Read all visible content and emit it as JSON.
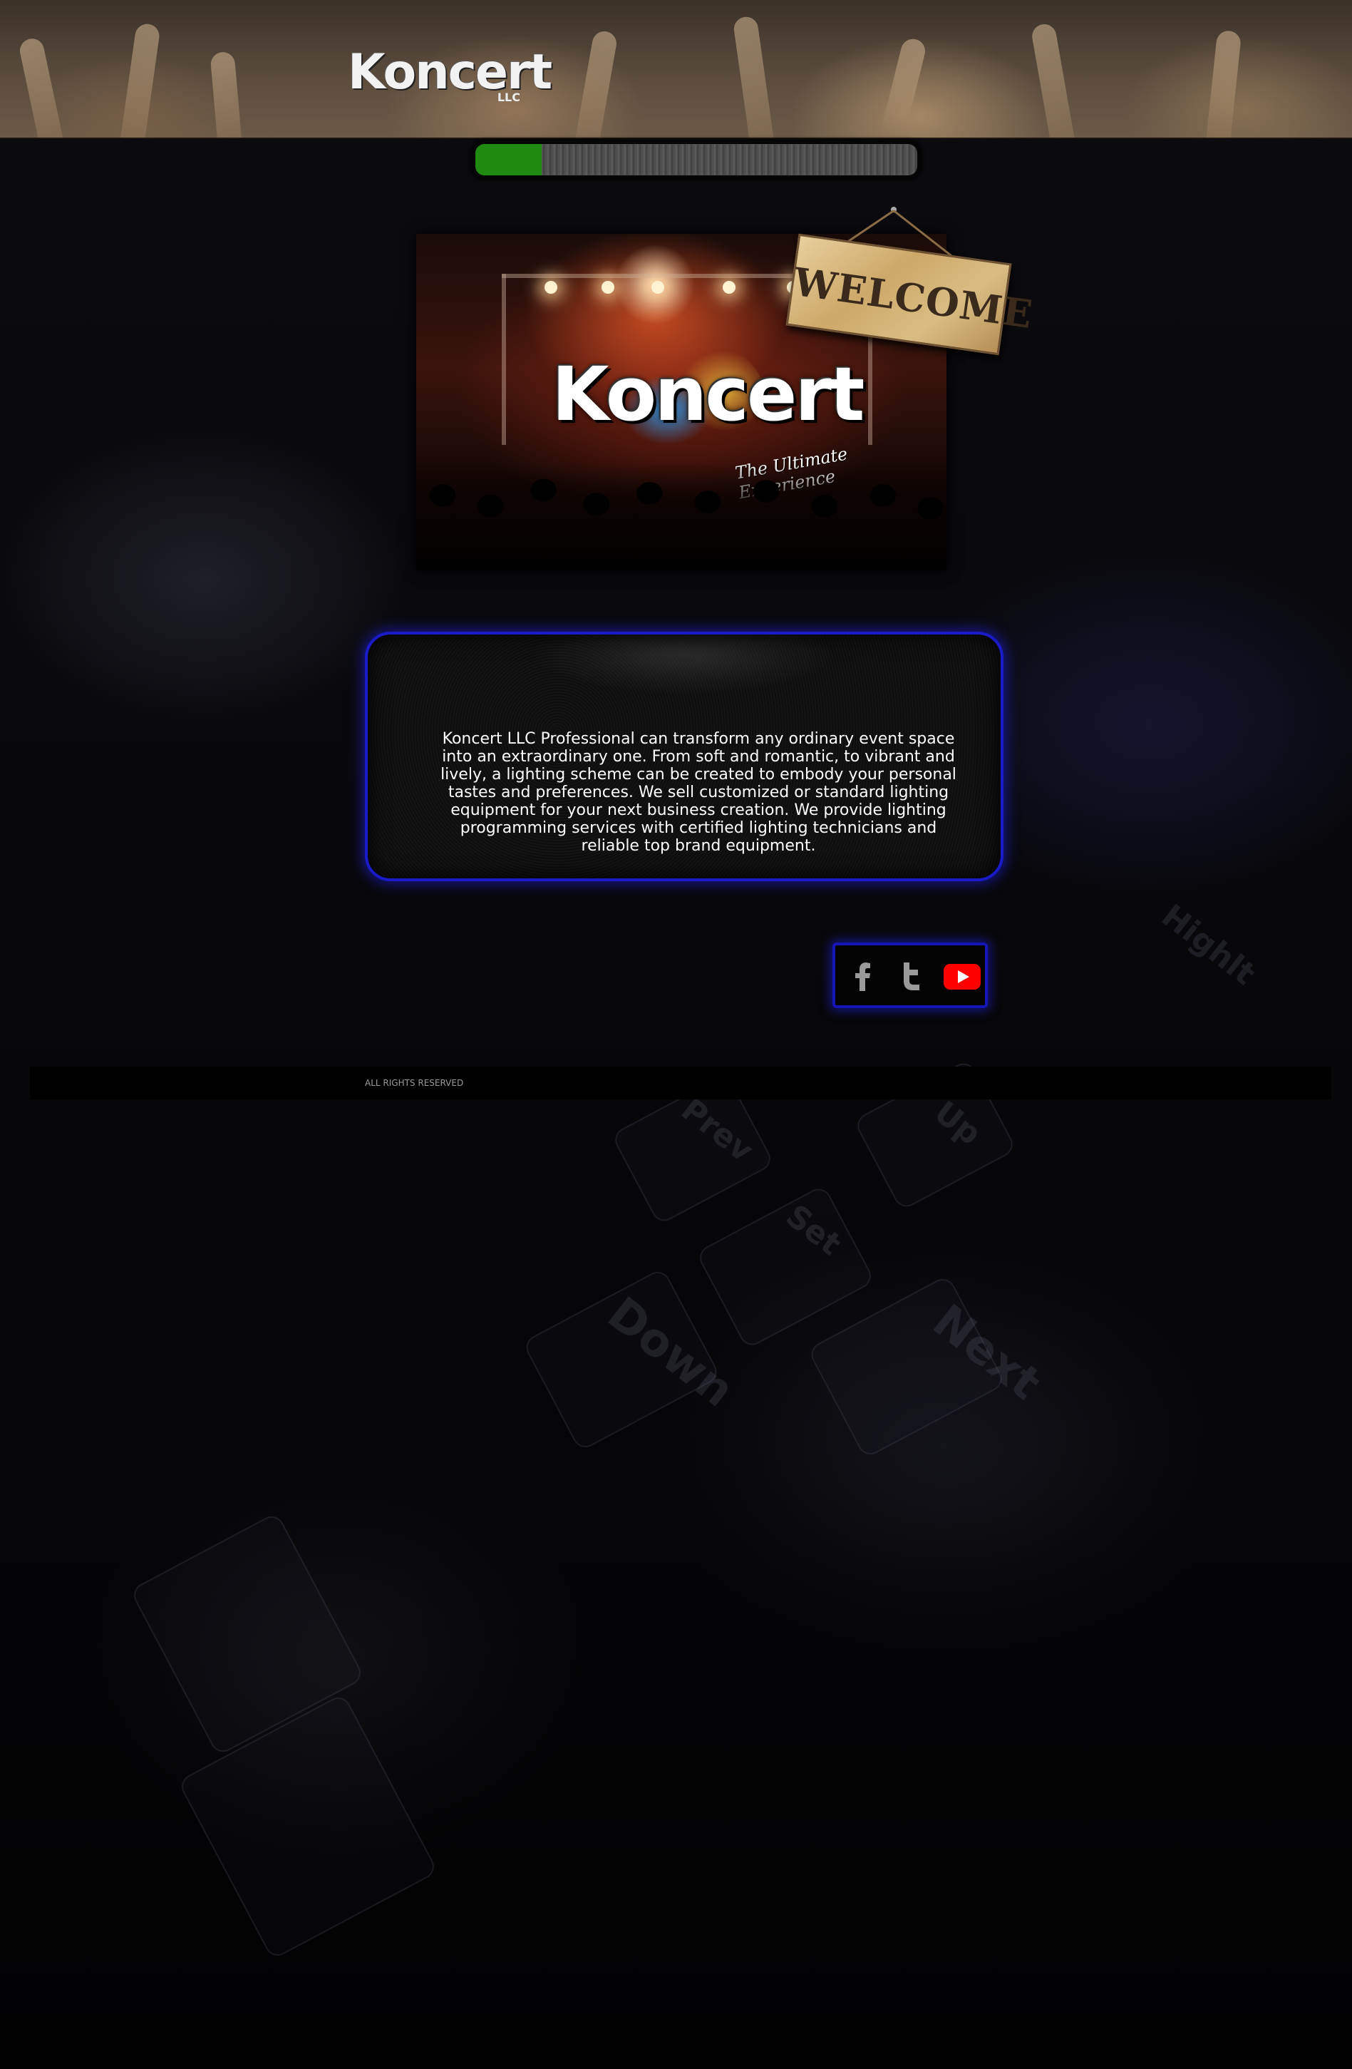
{
  "header": {
    "logo_main": "Koncert",
    "logo_sub": "LLC"
  },
  "progress": {
    "value_percent": 15,
    "fill_color": "#1e8a10"
  },
  "hero": {
    "brand": "Koncert",
    "tagline": "The Ultimate Experience",
    "sign_text": "WELCOME"
  },
  "about": {
    "text": "Koncert LLC Professional can transform any ordinary event space into an extraordinary one. From soft and romantic, to vibrant and lively, a lighting scheme can be created to embody your personal tastes and preferences. We sell customized or standard lighting equipment for your next business creation. We provide lighting programming services with certified lighting technicians and reliable top brand equipment."
  },
  "social": {
    "items": [
      {
        "icon": "facebook-icon",
        "color": "#9a9a9a"
      },
      {
        "icon": "twitter-icon",
        "color": "#9a9a9a"
      },
      {
        "icon": "youtube-icon",
        "color": "#ff0000"
      }
    ]
  },
  "footer": {
    "copyright": "ALL RIGHTS RESERVED"
  },
  "background": {
    "key_labels": [
      "Prev",
      "Up",
      "Set",
      "Down",
      "Next",
      "Highlt"
    ]
  }
}
